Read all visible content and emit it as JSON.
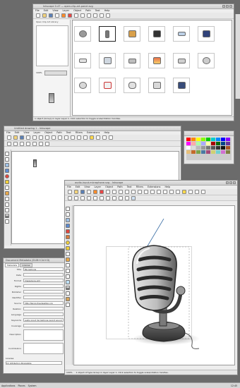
{
  "windows": {
    "top": {
      "title": "Inkscape 0.47 — open-clip-art-panel.svg",
      "menu": [
        "File",
        "Edit",
        "View",
        "Layer",
        "Object",
        "Path",
        "Text",
        "Help"
      ],
      "panel_title": "Open Clip Art Library",
      "panel_zoom": "100%",
      "status": "1 object (Group) in layer Layer 1. Click selection to toggle scale/rotation handles.",
      "zoom_status": "X: 372  Y: 189  Z: 100%"
    },
    "middle": {
      "title": "Untitled drawing 1 - Inkscape",
      "menu": [
        "File",
        "Edit",
        "View",
        "Layer",
        "Object",
        "Path",
        "Text",
        "Filters",
        "Extensions",
        "Help"
      ]
    },
    "main": {
      "title": "audio-input-microphone.svg - Inkscape",
      "menu": [
        "File",
        "Edit",
        "View",
        "Layer",
        "Object",
        "Path",
        "Text",
        "Filters",
        "Extensions",
        "Help"
      ],
      "status": "1 object of type Group in layer Layer 1. Click selection to toggle scale/rotation handles.",
      "zoom": "100%"
    },
    "metadata": {
      "title": "Document Metadata (Shift+Ctrl+D)",
      "tabs": [
        "Metadata",
        "License"
      ],
      "fields": [
        {
          "label": "Title",
          "value": "Microphone"
        },
        {
          "label": "Date",
          "value": ""
        },
        {
          "label": "Format",
          "value": "image/svg+xml"
        },
        {
          "label": "Rights",
          "value": ""
        },
        {
          "label": "Publisher",
          "value": ""
        },
        {
          "label": "Identifier",
          "value": ""
        },
        {
          "label": "Source",
          "value": "http://tango.freedesktop.org"
        },
        {
          "label": "Relation",
          "value": ""
        },
        {
          "label": "Language",
          "value": ""
        },
        {
          "label": "Keywords",
          "value": "audio input microphone record sound"
        },
        {
          "label": "Coverage",
          "value": ""
        },
        {
          "label": "Description",
          "value": ""
        },
        {
          "label": "Contributors",
          "value": ""
        }
      ],
      "license_label": "License",
      "license_value": "CC Attribution-ShareAlike"
    }
  },
  "taskbar": {
    "items": [
      "Applications",
      "Places",
      "System"
    ],
    "clock": "12:45"
  },
  "colors": {
    "desktop": "#6b6b6b",
    "accent": "#3a6ea5",
    "mic_dark": "#3b3b3b",
    "mic_light": "#d8d8d8"
  },
  "clip_icons": [
    "hard-disk-icon",
    "usb-drive-icon",
    "package-icon",
    "camera-icon",
    "scanner-icon",
    "monitor-icon",
    "keyboard-icon",
    "printer-icon",
    "drive-icon",
    "installer-icon",
    "network-icon",
    "media-icon",
    "cdrom-icon",
    "pda-icon",
    "mouse-icon",
    "printer-2-icon",
    "display-icon"
  ],
  "palette_colors": [
    "#ff0000",
    "#ff8800",
    "#ffff00",
    "#88ff00",
    "#00cc00",
    "#00cccc",
    "#0088ff",
    "#0000ff",
    "#8800ff",
    "#ff00ff",
    "#ffffff",
    "#cccccc",
    "#888888",
    "#444444",
    "#000000",
    "#aa5522",
    "#ffaaaa",
    "#aaffaa",
    "#aaaaff",
    "#ffffaa",
    "#aa0000",
    "#0a6a0a",
    "#004488",
    "#663399"
  ]
}
